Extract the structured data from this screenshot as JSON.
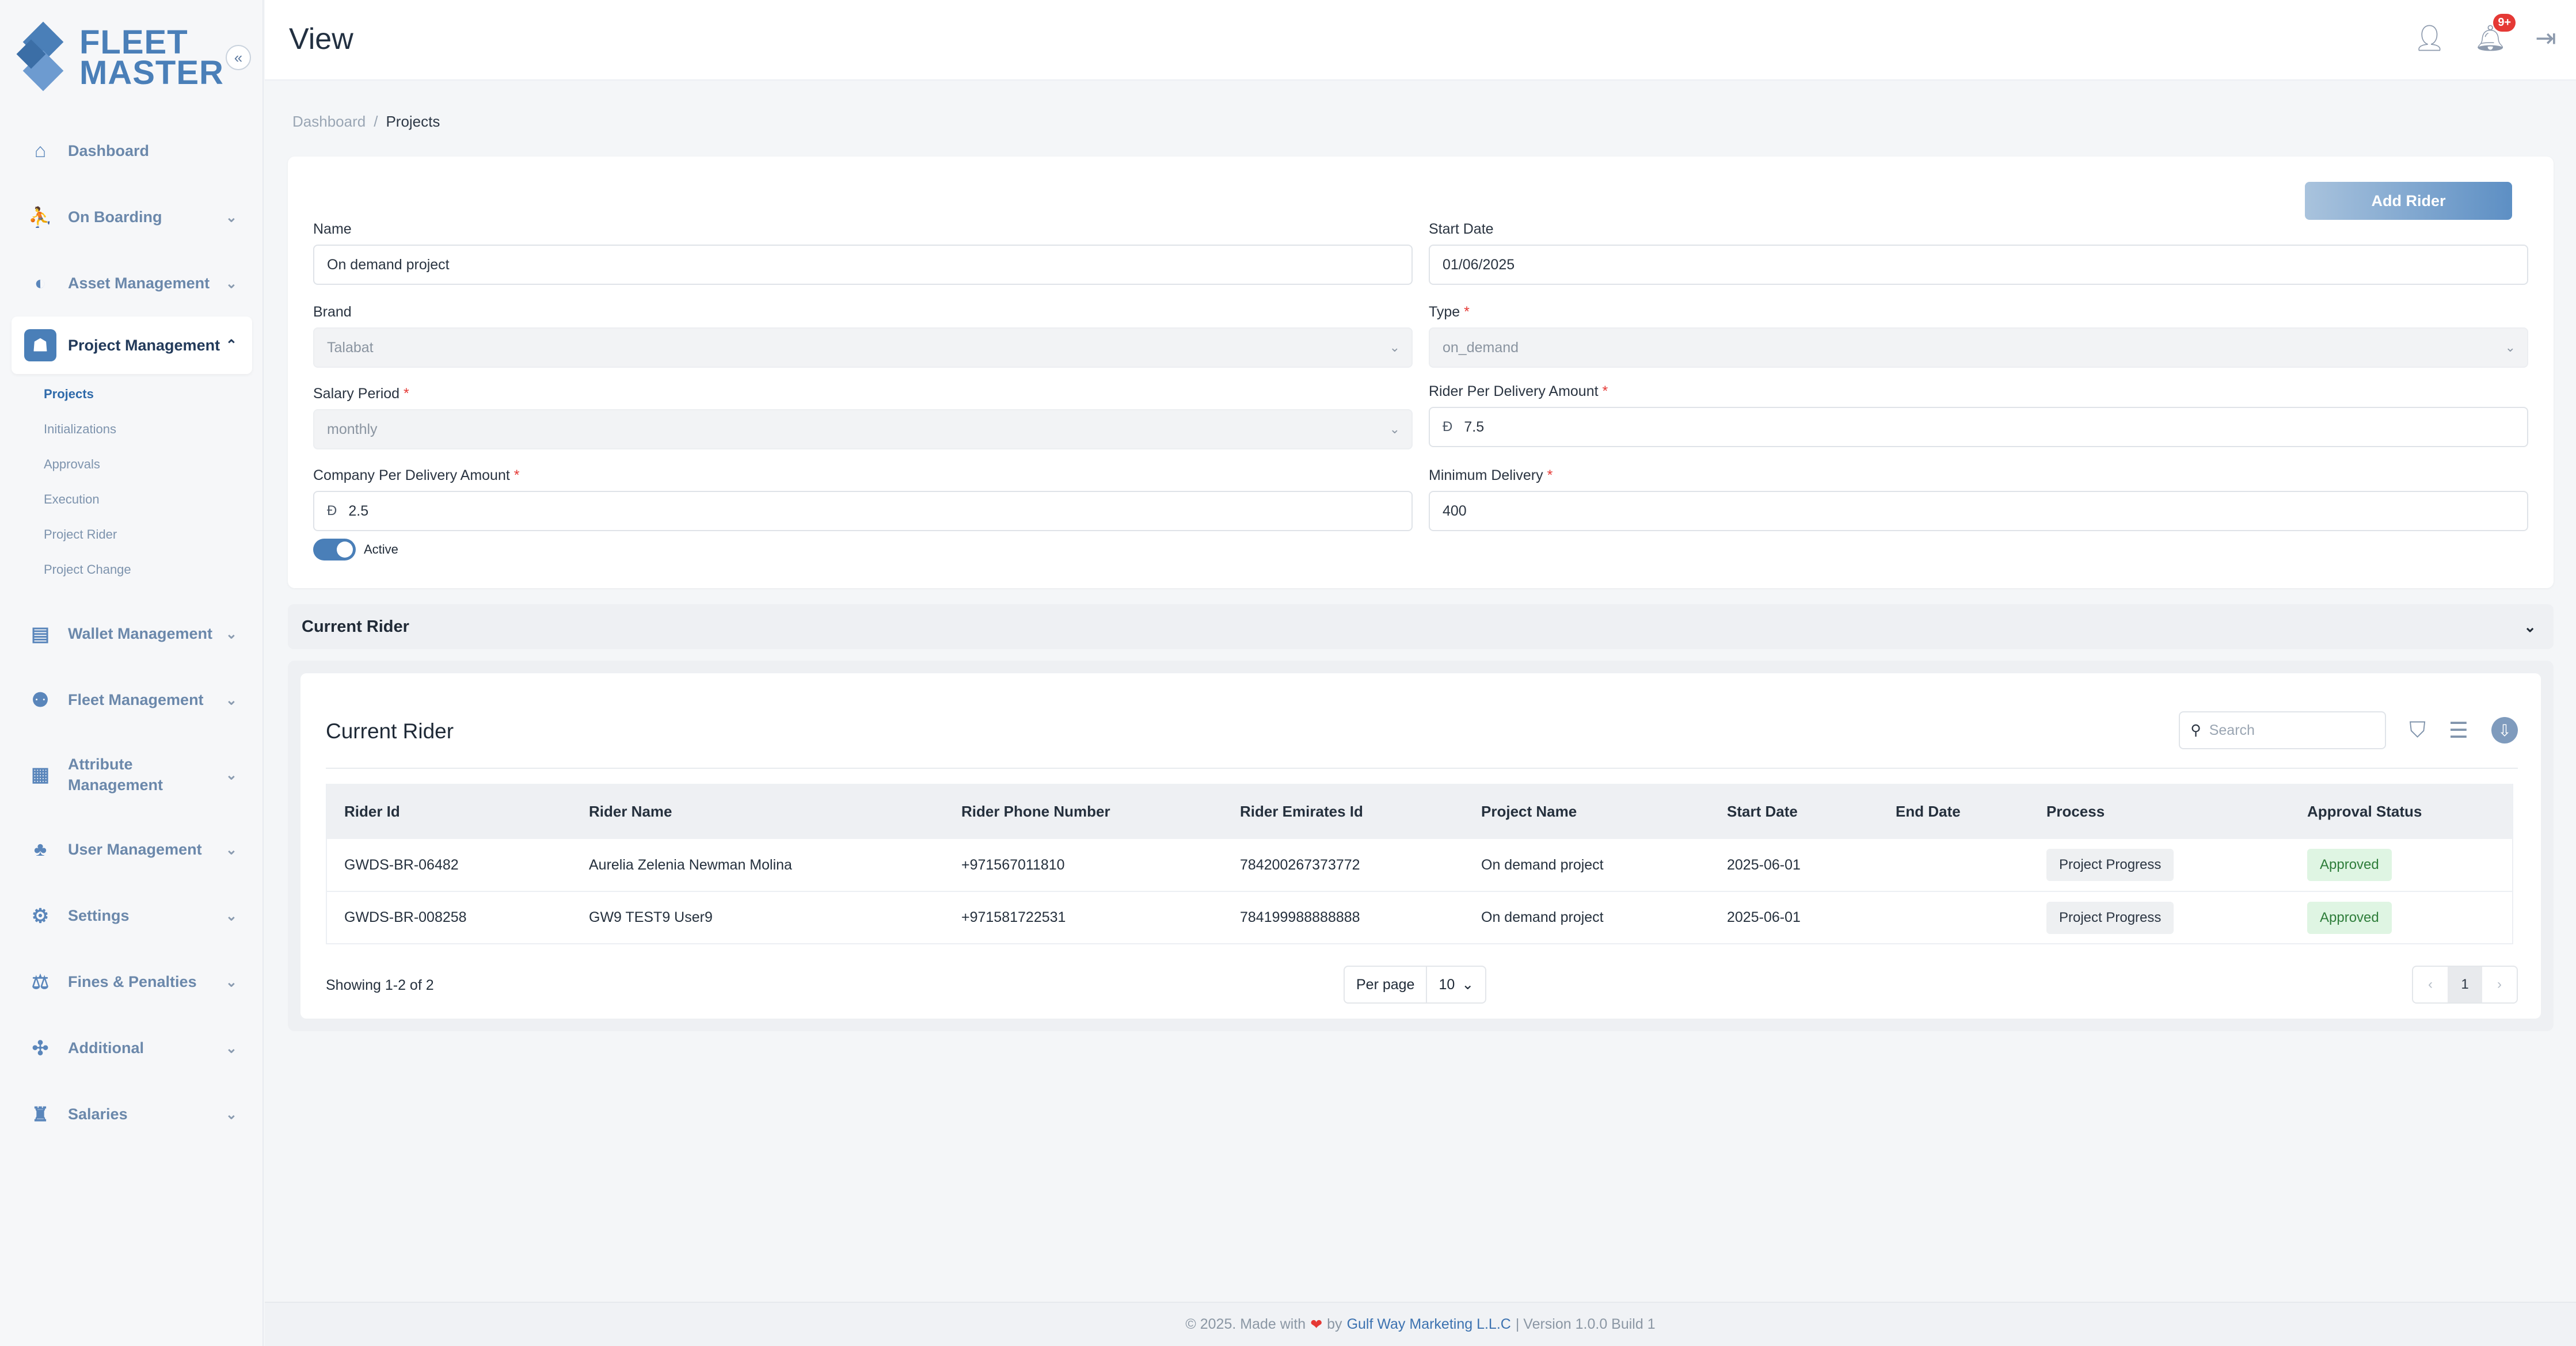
{
  "brand": {
    "line1": "FLEET",
    "line2": "MASTER",
    "collapse_icon": "«"
  },
  "sidebar": {
    "items": [
      {
        "label": "Dashboard",
        "icon": "home-icon",
        "glyph": "⌂"
      },
      {
        "label": "On Boarding",
        "icon": "onboarding-icon",
        "glyph": "⛹"
      },
      {
        "label": "Asset Management",
        "icon": "asset-icon",
        "glyph": "◐"
      },
      {
        "label": "Project Management",
        "icon": "project-icon",
        "glyph": "☗"
      },
      {
        "label": "Wallet Management",
        "icon": "wallet-icon",
        "glyph": "▤"
      },
      {
        "label": "Fleet Management",
        "icon": "fleet-icon",
        "glyph": "⚉"
      },
      {
        "label": "Attribute Management",
        "icon": "attribute-icon",
        "glyph": "▦"
      },
      {
        "label": "User Management",
        "icon": "users-icon",
        "glyph": "♣"
      },
      {
        "label": "Settings",
        "icon": "gear-icon",
        "glyph": "⚙"
      },
      {
        "label": "Fines & Penalties",
        "icon": "fines-icon",
        "glyph": "⚖"
      },
      {
        "label": "Additional",
        "icon": "additional-icon",
        "glyph": "✣"
      },
      {
        "label": "Salaries",
        "icon": "salaries-icon",
        "glyph": "♜"
      }
    ],
    "sub_items": [
      "Projects",
      "Initializations",
      "Approvals",
      "Execution",
      "Project Rider",
      "Project Change"
    ]
  },
  "header": {
    "title": "View",
    "notifications_badge": "9+"
  },
  "breadcrumb": {
    "home": "Dashboard",
    "separator": "/",
    "current": "Projects"
  },
  "form": {
    "add_rider_label": "Add Rider",
    "name": {
      "label": "Name",
      "value": "On demand project"
    },
    "start_date": {
      "label": "Start Date",
      "value": "01/06/2025"
    },
    "brand": {
      "label": "Brand",
      "value": "Talabat"
    },
    "type": {
      "label": "Type",
      "value": "on_demand"
    },
    "salary_period": {
      "label": "Salary Period",
      "value": "monthly"
    },
    "rider_per_delivery": {
      "label": "Rider Per Delivery Amount",
      "value": "7.5"
    },
    "company_per_delivery": {
      "label": "Company Per Delivery Amount",
      "value": "2.5"
    },
    "minimum_delivery": {
      "label": "Minimum Delivery",
      "value": "400"
    },
    "active_label": "Active",
    "active": true,
    "currency_symbol": "Ð",
    "required_mark": "*"
  },
  "accordion": {
    "title": "Current Rider"
  },
  "table": {
    "title": "Current Rider",
    "search_placeholder": "Search",
    "columns": [
      "Rider Id",
      "Rider Name",
      "Rider Phone Number",
      "Rider Emirates Id",
      "Project Name",
      "Start Date",
      "End Date",
      "Process",
      "Approval Status"
    ],
    "rows": [
      [
        "GWDS-BR-06482",
        "Aurelia Zelenia Newman Molina",
        "+971567011810",
        "784200267373772",
        "On demand project",
        "2025-06-01",
        "",
        "Project Progress",
        "Approved"
      ],
      [
        "GWDS-BR-008258",
        "GW9 TEST9 User9",
        "+971581722531",
        "784199988888888",
        "On demand project",
        "2025-06-01",
        "",
        "Project Progress",
        "Approved"
      ]
    ],
    "showing": "Showing 1-2 of 2",
    "per_page_label": "Per page",
    "per_page_value": "10",
    "current_page": "1"
  },
  "footer": {
    "prefix": "© 2025. Made with",
    "by": "by",
    "company": "Gulf Way Marketing L.L.C",
    "version": "| Version 1.0.0 Build 1"
  },
  "colors": {
    "accent": "#4a7fb8",
    "approved_bg": "#dff5e3",
    "badge": "#e53935"
  }
}
